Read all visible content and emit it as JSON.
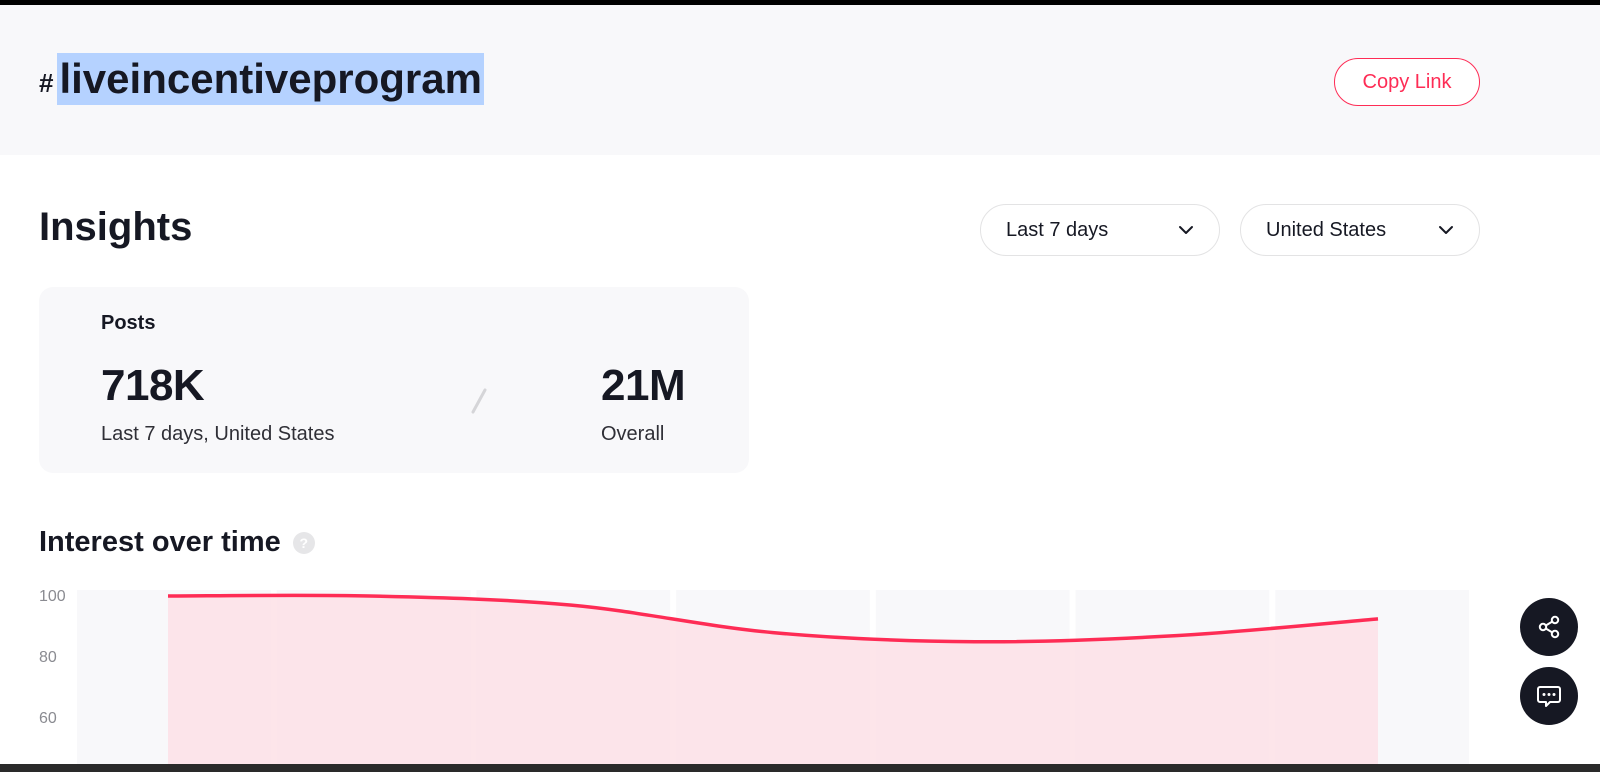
{
  "header": {
    "hash_symbol": "#",
    "hashtag": "liveincentiveprogram",
    "copy_link_label": "Copy Link"
  },
  "insights": {
    "title": "Insights",
    "period_filter": "Last 7 days",
    "country_filter": "United States"
  },
  "posts_card": {
    "label": "Posts",
    "recent_value": "718K",
    "recent_caption": "Last 7 days, United States",
    "overall_value": "21M",
    "overall_caption": "Overall"
  },
  "interest": {
    "title": "Interest over time",
    "help_icon": "question-mark-icon"
  },
  "chart_data": {
    "type": "area",
    "y_ticks": [
      100,
      80,
      60
    ],
    "ylim": [
      44,
      102
    ],
    "grid": false,
    "values": [
      100,
      100,
      97,
      88,
      85,
      87,
      92.5
    ],
    "color": "#fe2c55",
    "fill_color": "#fde0e6"
  },
  "floating": {
    "share_icon": "share-icon",
    "chat_icon": "chat-icon"
  },
  "colors": {
    "accent": "#fe2c55",
    "header_bg": "#f8f8fa",
    "selection": "#b5d2ff"
  }
}
